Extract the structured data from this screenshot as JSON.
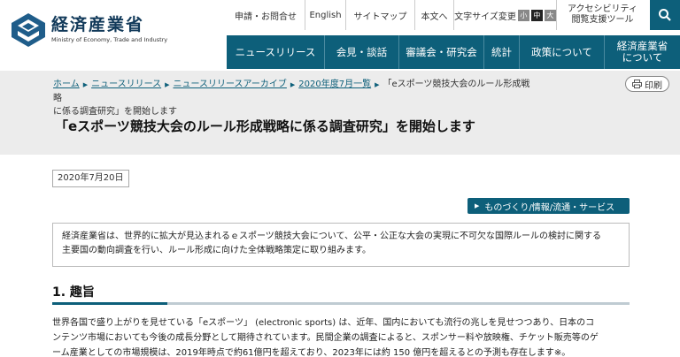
{
  "brand": {
    "name_ja": "経済産業省",
    "name_en": "Ministry of Economy, Trade and Industry",
    "color": "#0d5f7a"
  },
  "utility": {
    "inquiry": "申請・お問合せ",
    "english": "English",
    "sitemap": "サイトマップ",
    "text_only": "本文へ",
    "font_size_label": "文字サイズ変更",
    "font_small": "小",
    "font_medium": "中",
    "font_large": "大",
    "accessibility_line1": "アクセシビリティ",
    "accessibility_line2": "閲覧支援ツール",
    "search_icon": "search-icon"
  },
  "nav": {
    "items": [
      {
        "label": "ニュースリリース"
      },
      {
        "label": "会見・談話"
      },
      {
        "label": "審議会・研究会"
      },
      {
        "label": "統計"
      },
      {
        "label": "政策について"
      },
      {
        "label_line1": "経済産業省",
        "label_line2": "について"
      }
    ]
  },
  "breadcrumb": {
    "home": "ホーム",
    "news": "ニュースリリース",
    "archive": "ニュースリリースアーカイブ",
    "month": "2020年度7月一覧",
    "current_line1": "「eスポーツ競技大会のルール形成戦略",
    "current_line2": "に係る調査研究」を開始します"
  },
  "print_label": "印刷",
  "page_title": "「eスポーツ競技大会のルール形成戦略に係る調査研究」を開始します",
  "date": "2020年7月20日",
  "category": "ものづくり/情報/流通・サービス",
  "summary": {
    "line1": "経済産業省は、世界的に拡大が見込まれるｅスポーツ競技大会について、公平・公正な大会の実現に不可欠な国際ルールの検討に関する",
    "line2": "主要国の動向調査を行い、ルール形成に向けた全体戦略策定に取り組みます。"
  },
  "section1": {
    "heading": "1. 趣旨",
    "line1": "世界各国で盛り上がりを見せている「eスポーツ」 (electronic sports) は、近年、国内においても流行の兆しを見せつつあり、日本のコ",
    "line2": "ンテンツ市場においても今後の成長分野として期待されています。民間企業の調査によると、スポンサー料や放映権、チケット販売等のゲ",
    "line3": "ーム産業としての市場規模は、2019年時点で約61億円を超えており、2023年には約 150 億円を超えるとの予測も存在します※。"
  }
}
